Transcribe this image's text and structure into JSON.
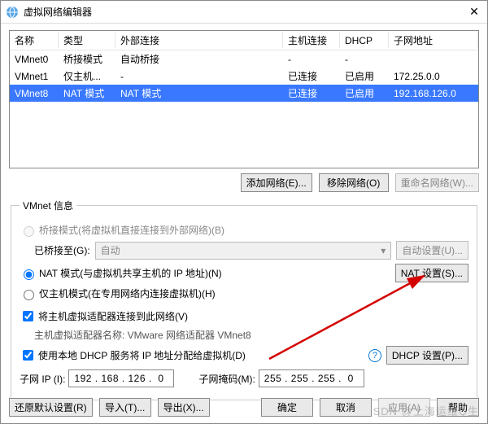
{
  "window": {
    "title": "虚拟网络编辑器"
  },
  "columns": {
    "name": "名称",
    "type": "类型",
    "external": "外部连接",
    "host": "主机连接",
    "dhcp": "DHCP",
    "subnet": "子网地址"
  },
  "rows": [
    {
      "name": "VMnet0",
      "type": "桥接模式",
      "external": "自动桥接",
      "host": "-",
      "dhcp": "-",
      "subnet": "",
      "selected": false
    },
    {
      "name": "VMnet1",
      "type": "仅主机...",
      "external": "-",
      "host": "已连接",
      "dhcp": "已启用",
      "subnet": "172.25.0.0",
      "selected": false
    },
    {
      "name": "VMnet8",
      "type": "NAT 模式",
      "external": "NAT 模式",
      "host": "已连接",
      "dhcp": "已启用",
      "subnet": "192.168.126.0",
      "selected": true
    }
  ],
  "buttons": {
    "add": "添加网络(E)...",
    "remove": "移除网络(O)",
    "rename": "重命名网络(W)...",
    "bridge_settings": "自动设置(U)...",
    "nat_settings": "NAT 设置(S)...",
    "dhcp_settings": "DHCP 设置(P)...",
    "restore": "还原默认设置(R)",
    "import": "导入(T)...",
    "export": "导出(X)...",
    "ok": "确定",
    "cancel": "取消",
    "apply": "应用(A)",
    "help": "帮助"
  },
  "section": {
    "legend": "VMnet 信息",
    "radio_bridge": "桥接模式(将虚拟机直接连接到外部网络)(B)",
    "bridge_to_label": "已桥接至(G):",
    "bridge_to_value": "自动",
    "radio_nat": "NAT 模式(与虚拟机共享主机的 IP 地址)(N)",
    "radio_host": "仅主机模式(在专用网络内连接虚拟机)(H)",
    "chk_host_adapter": "将主机虚拟适配器连接到此网络(V)",
    "host_adapter_name": "主机虚拟适配器名称: VMware 网络适配器 VMnet8",
    "chk_dhcp": "使用本地 DHCP 服务将 IP 地址分配给虚拟机(D)",
    "subnet_ip_label": "子网 IP (I):",
    "subnet_ip": "192 . 168 . 126 .  0",
    "subnet_mask_label": "子网掩码(M):",
    "subnet_mask": "255 . 255 . 255 .  0"
  },
  "watermark": "SDN @上海运维Q生"
}
